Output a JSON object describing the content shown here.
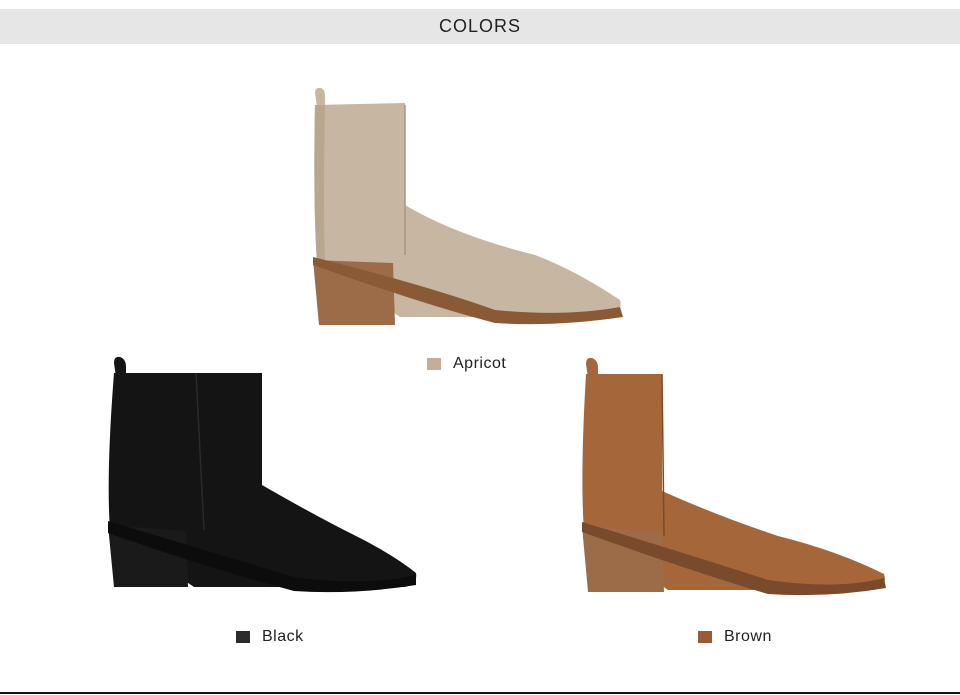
{
  "header": {
    "title": "COLORS"
  },
  "variants": [
    {
      "name": "Apricot",
      "swatch_color": "#c4ae98",
      "upper_color": "#c7b7a2",
      "upper_shade": "#b8a68f",
      "heel_color": "#9c6b47",
      "sole_color": "#8a5a37"
    },
    {
      "name": "Black",
      "swatch_color": "#2b2b2b",
      "upper_color": "#141414",
      "upper_shade": "#050505",
      "heel_color": "#1a1a1a",
      "sole_color": "#0c0c0c"
    },
    {
      "name": "Brown",
      "swatch_color": "#9a5a35",
      "upper_color": "#a5673a",
      "upper_shade": "#8f552d",
      "heel_color": "#9c6b47",
      "sole_color": "#7a4a2c"
    }
  ]
}
